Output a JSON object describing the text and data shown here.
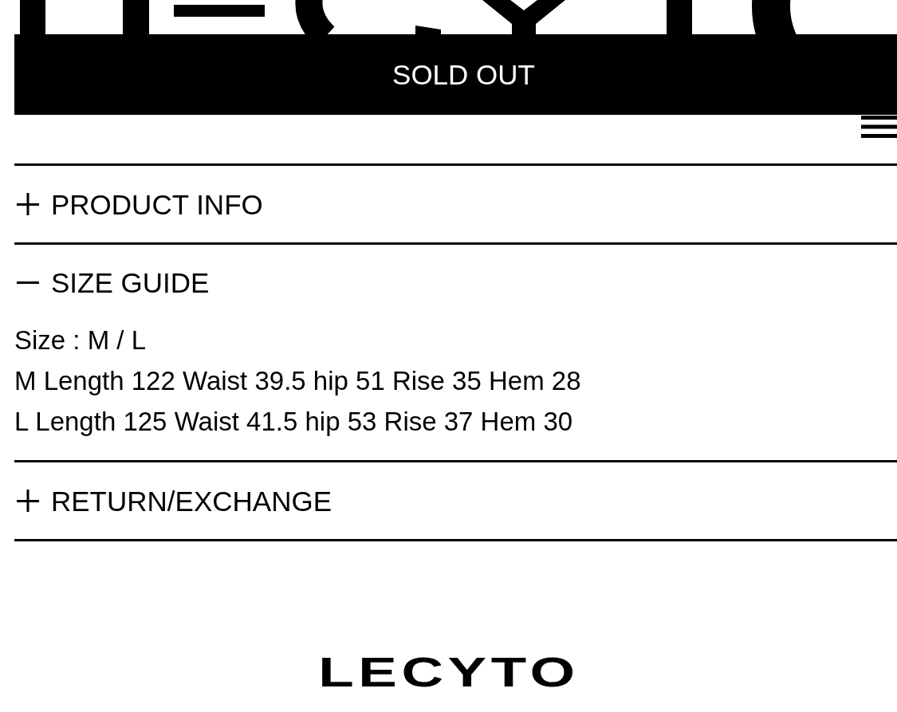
{
  "sold_out_button": {
    "label": "SOLD OUT"
  },
  "accordion": [
    {
      "title": "PRODUCT INFO",
      "expanded": false
    },
    {
      "title": "SIZE GUIDE",
      "expanded": true,
      "lines": [
        "Size : M / L",
        "M Length 122 Waist 39.5 hip 51 Rise 35 Hem 28",
        "L Length 125 Waist 41.5 hip 53 Rise 37 Hem 30"
      ]
    },
    {
      "title": "RETURN/EXCHANGE",
      "expanded": false
    }
  ],
  "footer": {
    "logo": "LECYTO"
  }
}
